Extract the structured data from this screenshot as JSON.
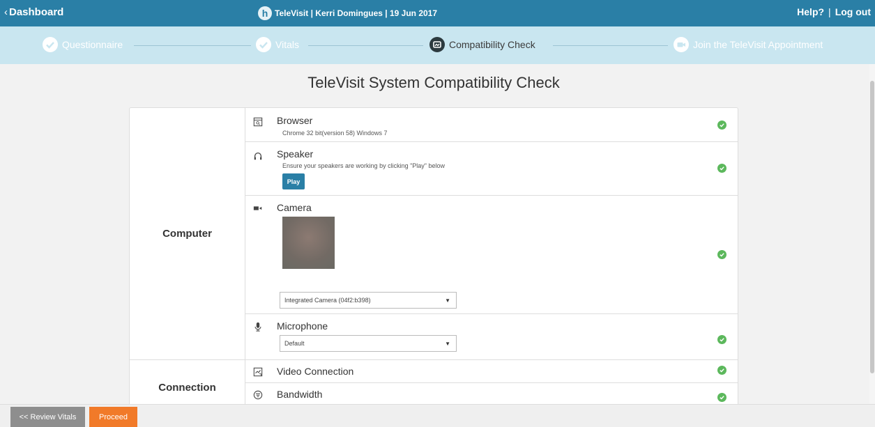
{
  "header": {
    "back_label": "Dashboard",
    "title": "TeleVisit | Kerri Domingues | 19 Jun 2017",
    "logo_letter": "h",
    "help_label": "Help?",
    "separator": "|",
    "logout_label": "Log out"
  },
  "steps": [
    {
      "label": "Questionnaire",
      "state": "completed",
      "icon": "check-circle-icon"
    },
    {
      "label": "Vitals",
      "state": "completed",
      "icon": "check-circle-icon"
    },
    {
      "label": "Compatibility Check",
      "state": "active",
      "icon": "compatibility-icon"
    },
    {
      "label": "Join the TeleVisit Appointment",
      "state": "pending",
      "icon": "video-call-icon"
    }
  ],
  "page": {
    "title": "TeleVisit System Compatibility Check"
  },
  "groups": {
    "computer": "Computer",
    "connection": "Connection"
  },
  "checks": {
    "browser": {
      "name": "Browser",
      "detail": "Chrome 32 bit(version  58) Windows 7",
      "status": "ok"
    },
    "speaker": {
      "name": "Speaker",
      "detail": "Ensure your speakers are working by clicking \"Play\" below",
      "button": "Play",
      "status": "ok"
    },
    "camera": {
      "name": "Camera",
      "selected": "Integrated Camera (04f2:b398)",
      "status": "ok"
    },
    "microphone": {
      "name": "Microphone",
      "selected": "Default",
      "status": "ok"
    },
    "video_connection": {
      "name": "Video Connection",
      "status": "ok"
    },
    "bandwidth": {
      "name": "Bandwidth",
      "status": "ok"
    }
  },
  "footer": {
    "review_label": "<< Review Vitals",
    "proceed_label": "Proceed"
  },
  "colors": {
    "header": "#2a7fa6",
    "steps_bg": "#c9e6f0",
    "ok": "#5cb85c",
    "proceed": "#f17a29",
    "review": "#8e8e8e"
  }
}
